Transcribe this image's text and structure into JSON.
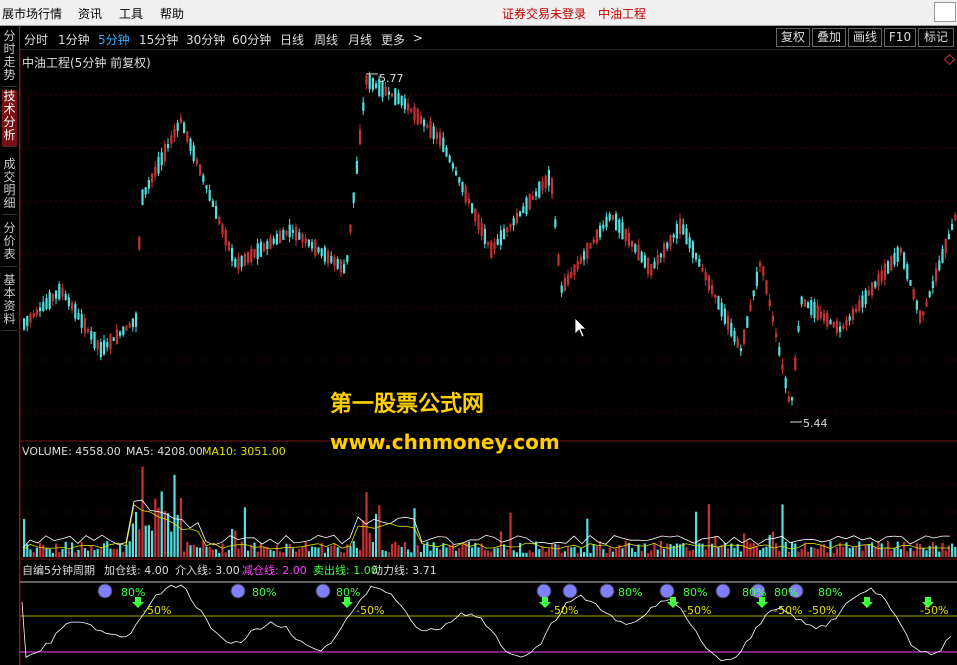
{
  "menubar": {
    "items": [
      "展市场行情",
      "资讯",
      "工具",
      "帮助"
    ],
    "status_login": "证券交易未登录",
    "status_stock": "中油工程"
  },
  "left_tabs": [
    {
      "label": "分时走势",
      "active": false
    },
    {
      "label": "技术分析",
      "active": true
    },
    {
      "label": "成交明细",
      "active": false
    },
    {
      "label": "分价表",
      "active": false
    },
    {
      "label": "基本资料",
      "active": false
    }
  ],
  "period_bar": {
    "periods": [
      "分时",
      "1分钟",
      "5分钟",
      "15分钟",
      "30分钟",
      "60分钟",
      "日线",
      "周线",
      "月线",
      "更多"
    ],
    "active_index": 2,
    "more_arrow": ">",
    "right_buttons": [
      "复权",
      "叠加",
      "画线",
      "F10",
      "标记"
    ]
  },
  "main_chart": {
    "title": "中油工程(5分钟 前复权)",
    "high_label": "5.77",
    "low_label": "5.44"
  },
  "volume_panel": {
    "volume_label": "VOLUME: 4558.00",
    "ma5_label": "MA5: 4208.00",
    "ma10_label": "MA10: 3051.00"
  },
  "indicator_panel": {
    "name": "自编5分钟周期",
    "jia": "加仓线: 4.00",
    "jieru": "介入线: 3.00",
    "jiancang": "减仓线: 2.00",
    "maichu": "卖出线: 1.00",
    "dongli": "动力线: 3.71",
    "pct80": "80%",
    "pct50": "-50%"
  },
  "watermark": {
    "line1": "第一股票公式网",
    "line2": "www.chnmoney.com"
  },
  "colors": {
    "up": "#c83232",
    "down": "#54e0e0",
    "accent_blue": "#3aa0ff",
    "ma5": "#ffffff",
    "ma10": "#e0e000",
    "jiancang": "#ff40ff",
    "maichu": "#40ff40"
  }
}
